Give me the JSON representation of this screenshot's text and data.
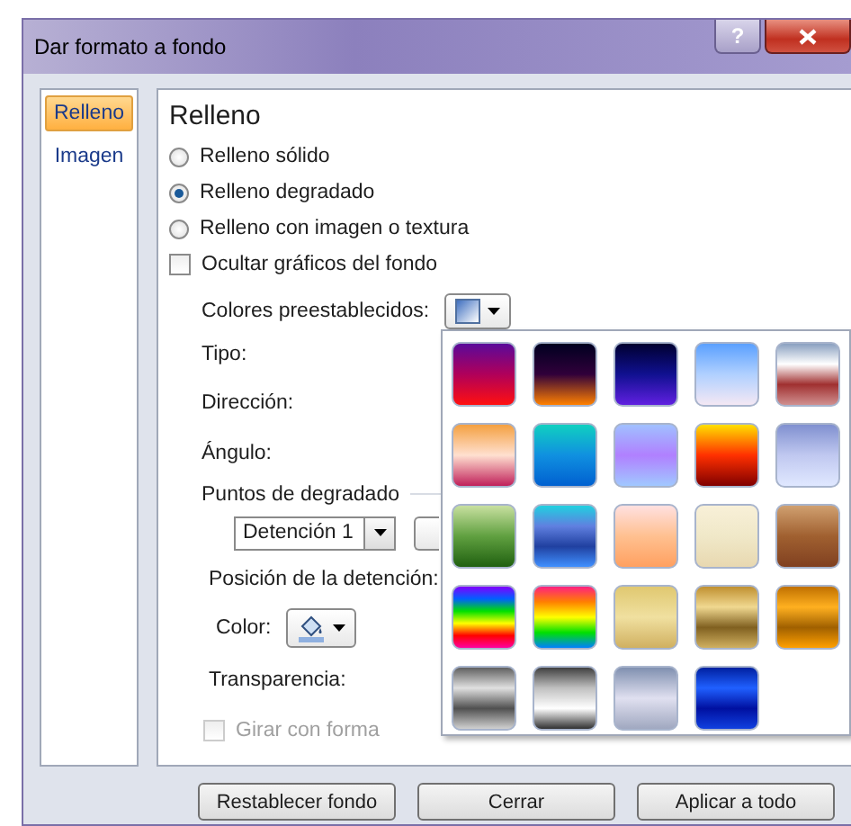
{
  "window": {
    "title": "Dar formato a fondo",
    "help": "?"
  },
  "nav": [
    {
      "label": "Relleno",
      "selected": true
    },
    {
      "label": "Imagen",
      "selected": false
    }
  ],
  "panel": {
    "heading": "Relleno",
    "fill_options": [
      {
        "kind": "radio",
        "label": "Relleno sólido",
        "selected": false
      },
      {
        "kind": "radio",
        "label": "Relleno degradado",
        "selected": true
      },
      {
        "kind": "radio",
        "label": "Relleno con imagen o textura",
        "selected": false
      },
      {
        "kind": "checkbox",
        "label": "Ocultar gráficos del fondo",
        "checked": false
      }
    ],
    "preset_label": "Colores preestablecidos:",
    "field_labels": [
      "Tipo:",
      "Dirección:",
      "Ángulo:"
    ],
    "stops_heading": "Puntos de degradado",
    "stop_dropdown": {
      "value": "Detención 1"
    },
    "position_label": "Posición de la detención:",
    "color_label": "Color:",
    "transparency_label": "Transparencia:",
    "rotate": {
      "label": "Girar con forma",
      "checked": false,
      "disabled": true
    }
  },
  "presets_popup": {
    "swatches": [
      {
        "kind": "gradient"
      },
      {
        "kind": "gradient"
      },
      {
        "kind": "gradient"
      },
      {
        "kind": "gradient"
      },
      {
        "kind": "gradient"
      },
      {
        "kind": "gradient"
      },
      {
        "kind": "gradient"
      },
      {
        "kind": "gradient"
      },
      {
        "kind": "gradient"
      },
      {
        "kind": "gradient"
      },
      {
        "kind": "gradient"
      },
      {
        "kind": "gradient"
      },
      {
        "kind": "gradient"
      },
      {
        "kind": "gradient"
      },
      {
        "kind": "gradient"
      },
      {
        "kind": "gradient"
      },
      {
        "kind": "gradient"
      },
      {
        "kind": "gradient"
      },
      {
        "kind": "gradient"
      },
      {
        "kind": "gradient"
      },
      {
        "kind": "gradient"
      },
      {
        "kind": "gradient"
      },
      {
        "kind": "gradient"
      },
      {
        "kind": "gradient"
      }
    ]
  },
  "buttons": [
    "Restablecer fondo",
    "Cerrar",
    "Aplicar a todo"
  ]
}
